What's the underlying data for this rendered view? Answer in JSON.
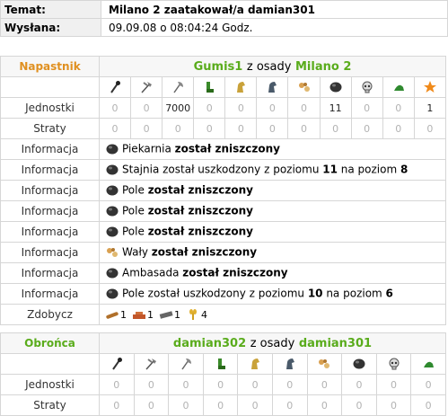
{
  "header": {
    "subject_label": "Temat:",
    "subject_value": "Milano 2 zaatakował/a damian301",
    "sent_label": "Wysłana:",
    "sent_value": "09.09.08 o 08:04:24 Godz."
  },
  "attacker": {
    "role": "Napastnik",
    "player": "Gumis1",
    "from_text": "z osady",
    "village": "Milano 2",
    "units_label": "Jednostki",
    "losses_label": "Straty",
    "unit_icons": [
      "mace-icon",
      "axe-icon",
      "battle-axe-icon",
      "boot-icon",
      "horse-icon",
      "knight-horse-icon",
      "ram-icon",
      "catapult-stone-icon",
      "skull-icon",
      "settler-hat-icon",
      "hero-star-icon"
    ],
    "units": [
      "0",
      "0",
      "7000",
      "0",
      "0",
      "0",
      "0",
      "11",
      "0",
      "0",
      "1"
    ],
    "losses": [
      "0",
      "0",
      "0",
      "0",
      "0",
      "0",
      "0",
      "0",
      "0",
      "0",
      "0"
    ],
    "info_label": "Informacja",
    "info": [
      {
        "icon": "catapult-stone-icon",
        "pre": "Piekarnia",
        "bold": "został zniszczony",
        "post": ""
      },
      {
        "icon": "catapult-stone-icon",
        "pre": "Stajnia został uszkodzony z poziomu",
        "bold": "11",
        "mid": "na poziom",
        "bold2": "8"
      },
      {
        "icon": "catapult-stone-icon",
        "pre": "Pole",
        "bold": "został zniszczony",
        "post": ""
      },
      {
        "icon": "catapult-stone-icon",
        "pre": "Pole",
        "bold": "został zniszczony",
        "post": ""
      },
      {
        "icon": "catapult-stone-icon",
        "pre": "Pole",
        "bold": "został zniszczony",
        "post": ""
      },
      {
        "icon": "ram-icon",
        "pre": "Wały",
        "bold": "został zniszczony",
        "post": ""
      },
      {
        "icon": "catapult-stone-icon",
        "pre": "Ambasada",
        "bold": "został zniszczony",
        "post": ""
      },
      {
        "icon": "catapult-stone-icon",
        "pre": "Pole został uszkodzony z poziomu",
        "bold": "10",
        "mid": "na poziom",
        "bold2": "6"
      }
    ],
    "loot_label": "Zdobycz",
    "loot": [
      {
        "icon": "wood-icon",
        "value": "1"
      },
      {
        "icon": "clay-icon",
        "value": "1"
      },
      {
        "icon": "iron-icon",
        "value": "1"
      },
      {
        "icon": "crop-icon",
        "value": "4"
      }
    ]
  },
  "defender": {
    "role": "Obrońca",
    "player": "damian302",
    "from_text": "z osady",
    "village": "damian301",
    "units_label": "Jednostki",
    "losses_label": "Straty",
    "unit_icons": [
      "mace-icon",
      "axe-icon",
      "battle-axe-icon",
      "boot-icon",
      "horse-icon",
      "knight-horse-icon",
      "ram-icon",
      "catapult-stone-icon",
      "skull-icon",
      "settler-hat-icon"
    ],
    "units": [
      "0",
      "0",
      "0",
      "0",
      "0",
      "0",
      "0",
      "0",
      "0",
      "0"
    ],
    "losses": [
      "0",
      "0",
      "0",
      "0",
      "0",
      "0",
      "0",
      "0",
      "0",
      "0"
    ]
  }
}
